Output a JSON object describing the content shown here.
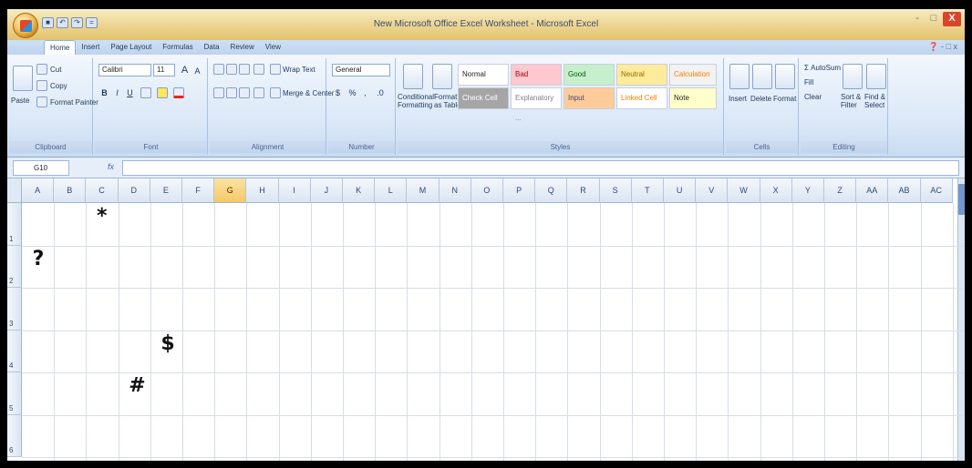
{
  "window": {
    "title": "New Microsoft Office Excel Worksheet - Microsoft Excel",
    "minimize": "-",
    "restore": "□",
    "close": "X"
  },
  "quick_access": [
    "■",
    "↶",
    "↷",
    "="
  ],
  "tabs": [
    "Home",
    "Insert",
    "Page Layout",
    "Formulas",
    "Data",
    "Review",
    "View"
  ],
  "help_label": "❓ - □ x",
  "ribbon": {
    "clipboard": {
      "label": "Clipboard",
      "paste": "Paste",
      "cut": "Cut",
      "copy": "Copy",
      "format_painter": "Format Painter"
    },
    "font": {
      "label": "Font",
      "name": "Calibri",
      "size": "11",
      "grow": "A",
      "shrink": "A",
      "bold": "B",
      "italic": "I",
      "underline": "U"
    },
    "alignment": {
      "label": "Alignment",
      "wrap_text": "Wrap Text",
      "merge_center": "Merge & Center"
    },
    "number": {
      "label": "Number",
      "format": "General",
      "currency": "$",
      "percent": "%",
      "comma": ",",
      "inc_dec": ".0"
    },
    "styles": {
      "label": "Styles",
      "conditional": "Conditional",
      "conditional2": "Formatting",
      "format_as": "Format",
      "format_as2": "as Table",
      "cells": [
        {
          "text": "Normal",
          "bg": "#ffffff",
          "fg": "#222222"
        },
        {
          "text": "Bad",
          "bg": "#ffc7ce",
          "fg": "#9c0006"
        },
        {
          "text": "Good",
          "bg": "#c6efce",
          "fg": "#006100"
        },
        {
          "text": "Neutral",
          "bg": "#ffeb9c",
          "fg": "#9c6500"
        },
        {
          "text": "Calculation",
          "bg": "#f2f2f2",
          "fg": "#fa7d00"
        },
        {
          "text": "Check Cell",
          "bg": "#a5a5a5",
          "fg": "#ffffff"
        },
        {
          "text": "Explanatory ...",
          "bg": "#ffffff",
          "fg": "#7f7f7f"
        },
        {
          "text": "Input",
          "bg": "#ffcc99",
          "fg": "#3f3f76"
        },
        {
          "text": "Linked Cell",
          "bg": "#ffffff",
          "fg": "#fa7d00"
        },
        {
          "text": "Note",
          "bg": "#ffffcc",
          "fg": "#222222"
        }
      ]
    },
    "cells": {
      "label": "Cells",
      "insert": "Insert",
      "delete": "Delete",
      "format": "Format"
    },
    "editing": {
      "label": "Editing",
      "autosum": "AutoSum",
      "fill": "Fill",
      "clear": "Clear",
      "sort": "Sort &",
      "sort2": "Filter",
      "find": "Find &",
      "find2": "Select"
    }
  },
  "formula_bar": {
    "name_box": "G10",
    "fx": "fx",
    "value": ""
  },
  "columns": [
    "A",
    "B",
    "C",
    "D",
    "E",
    "F",
    "G",
    "H",
    "I",
    "J",
    "K",
    "L",
    "M",
    "N",
    "O",
    "P",
    "Q",
    "R",
    "S",
    "T",
    "U",
    "V",
    "W",
    "X",
    "Y",
    "Z",
    "AA",
    "AB",
    "AC"
  ],
  "selected_column": "G",
  "rows": [
    "1",
    "2",
    "3",
    "4",
    "5",
    "6"
  ],
  "cells": [
    {
      "ref": "C1",
      "value": "*"
    },
    {
      "ref": "A2",
      "value": "?"
    },
    {
      "ref": "E4",
      "value": "$"
    },
    {
      "ref": "D5",
      "value": "#"
    }
  ]
}
